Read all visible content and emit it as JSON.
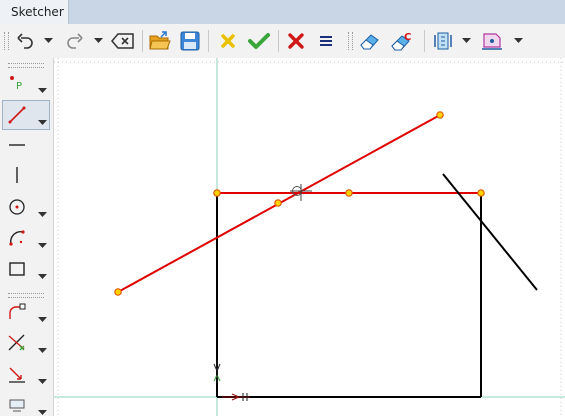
{
  "window": {
    "tab_title": "Sketcher"
  },
  "toolbar": {
    "buttons": [
      {
        "name": "undo",
        "icon": "undo-icon"
      },
      {
        "name": "undo-dropdown",
        "icon": "chevron-down-icon"
      },
      {
        "name": "redo",
        "icon": "redo-icon"
      },
      {
        "name": "redo-dropdown",
        "icon": "chevron-down-icon"
      },
      {
        "name": "backspace",
        "icon": "backspace-icon"
      },
      {
        "name": "open",
        "icon": "open-folder-icon"
      },
      {
        "name": "save",
        "icon": "save-icon"
      },
      {
        "name": "cancel-sketch",
        "icon": "yellow-x-icon"
      },
      {
        "name": "accept-sketch",
        "icon": "green-check-icon"
      },
      {
        "name": "delete",
        "icon": "red-x-icon"
      },
      {
        "name": "menu",
        "icon": "menu-icon"
      },
      {
        "name": "eraser",
        "icon": "eraser-icon"
      },
      {
        "name": "construction-toggle",
        "icon": "construction-eraser-icon"
      },
      {
        "name": "view-sketch",
        "icon": "view-sketch-icon"
      },
      {
        "name": "view-section",
        "icon": "view-section-icon"
      }
    ]
  },
  "left_toolbar": {
    "tools": [
      {
        "name": "point",
        "icon": "point-tool-icon",
        "label": "P"
      },
      {
        "name": "line",
        "icon": "line-tool-icon",
        "selected": true
      },
      {
        "name": "horizontal-line",
        "icon": "horizontal-line-icon"
      },
      {
        "name": "vertical-line",
        "icon": "vertical-line-icon"
      },
      {
        "name": "circle",
        "icon": "circle-tool-icon"
      },
      {
        "name": "arc",
        "icon": "arc-tool-icon"
      },
      {
        "name": "rectangle",
        "icon": "rectangle-tool-icon"
      },
      {
        "name": "fillet",
        "icon": "fillet-tool-icon"
      },
      {
        "name": "trim",
        "icon": "trim-tool-icon"
      },
      {
        "name": "extend",
        "icon": "extend-tool-icon"
      },
      {
        "name": "external-geometry",
        "icon": "external-geometry-icon"
      }
    ]
  },
  "colors": {
    "selected_geometry": "#e00000",
    "normal_geometry": "#000000",
    "vertex_fill": "#ffd200",
    "vertex_stroke": "#e05a00",
    "axis": "#8fd0b8",
    "title_bar": "#c9d6e5"
  }
}
